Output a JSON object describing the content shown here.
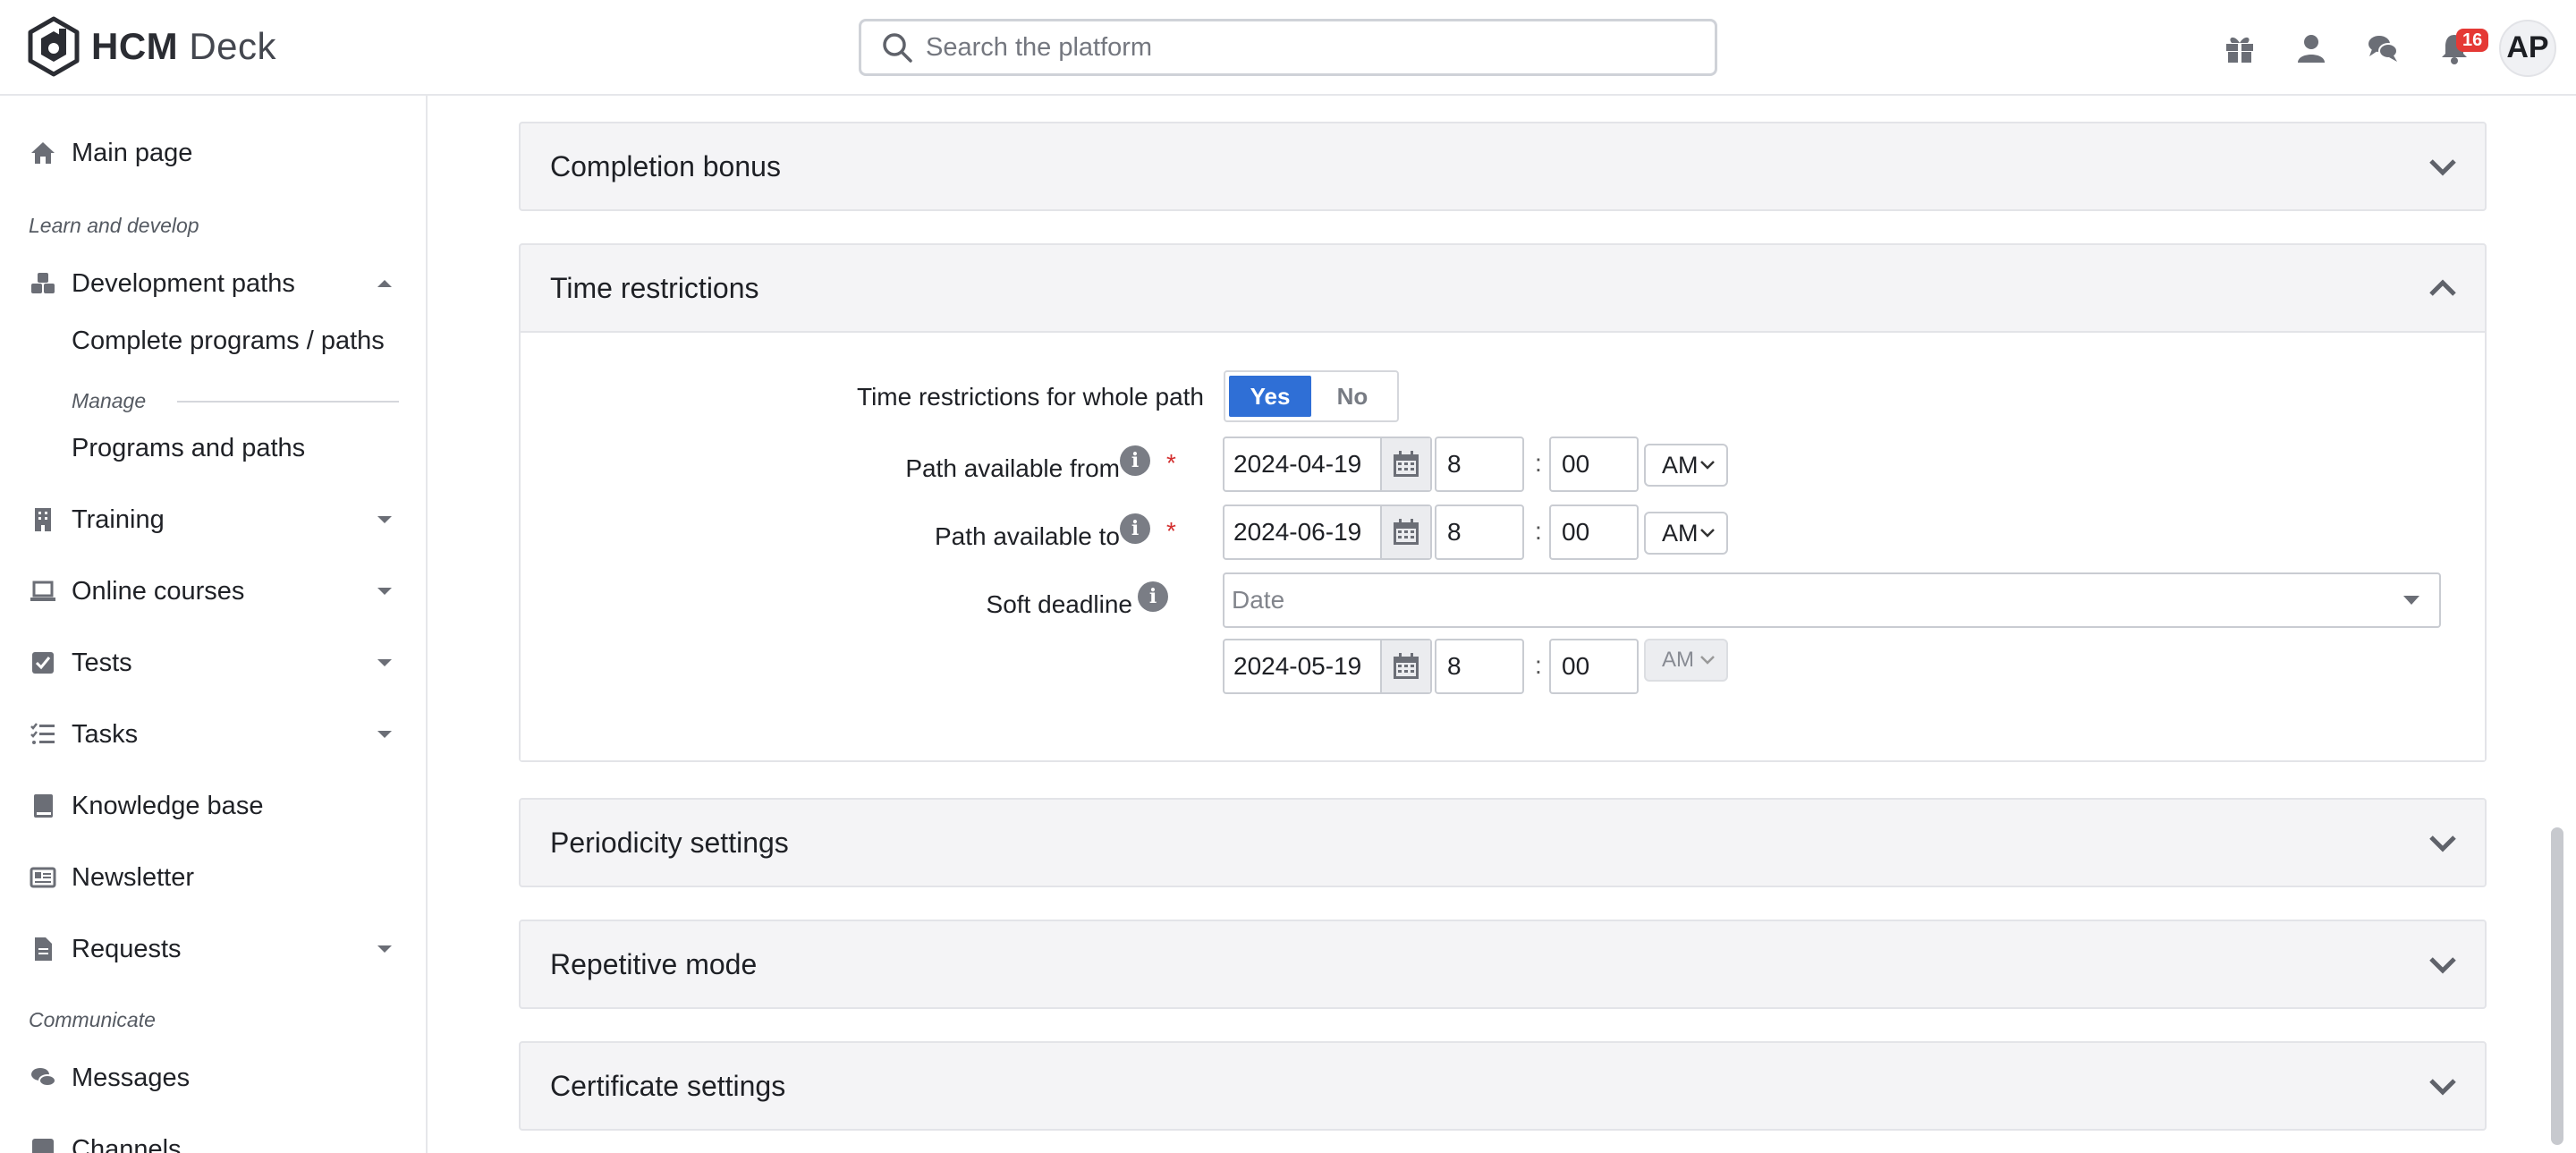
{
  "app": {
    "logo_bold": "HCM",
    "logo_light": "Deck",
    "search_placeholder": "Search the platform",
    "notifications_count": "16",
    "user_initials": "AP"
  },
  "sidebar": {
    "main_page": "Main page",
    "section_learn": "Learn and develop",
    "development_paths": "Development paths",
    "complete_programs": "Complete programs / paths",
    "manage": "Manage",
    "programs_and_paths": "Programs and paths",
    "training": "Training",
    "online_courses": "Online courses",
    "tests": "Tests",
    "tasks": "Tasks",
    "knowledge_base": "Knowledge base",
    "newsletter": "Newsletter",
    "requests": "Requests",
    "section_communicate": "Communicate",
    "messages": "Messages",
    "channels": "Channels"
  },
  "panels": {
    "completion_bonus": "Completion bonus",
    "time_restrictions": "Time restrictions",
    "periodicity": "Periodicity settings",
    "repetitive": "Repetitive mode",
    "certificate": "Certificate settings"
  },
  "time_restrictions": {
    "whole_path_label": "Time restrictions for whole path",
    "yes": "Yes",
    "no": "No",
    "from_label": "Path available from",
    "from_date": "2024-04-19",
    "from_hour": "8",
    "from_min": "00",
    "from_ampm": "AM",
    "to_label": "Path available to",
    "to_date": "2024-06-19",
    "to_hour": "8",
    "to_min": "00",
    "to_ampm": "AM",
    "soft_label": "Soft deadline",
    "soft_select": "Date",
    "soft_date": "2024-05-19",
    "soft_hour": "8",
    "soft_min": "00",
    "soft_ampm": "AM",
    "colon": ":",
    "required_mark": "*",
    "info_glyph": "i"
  }
}
